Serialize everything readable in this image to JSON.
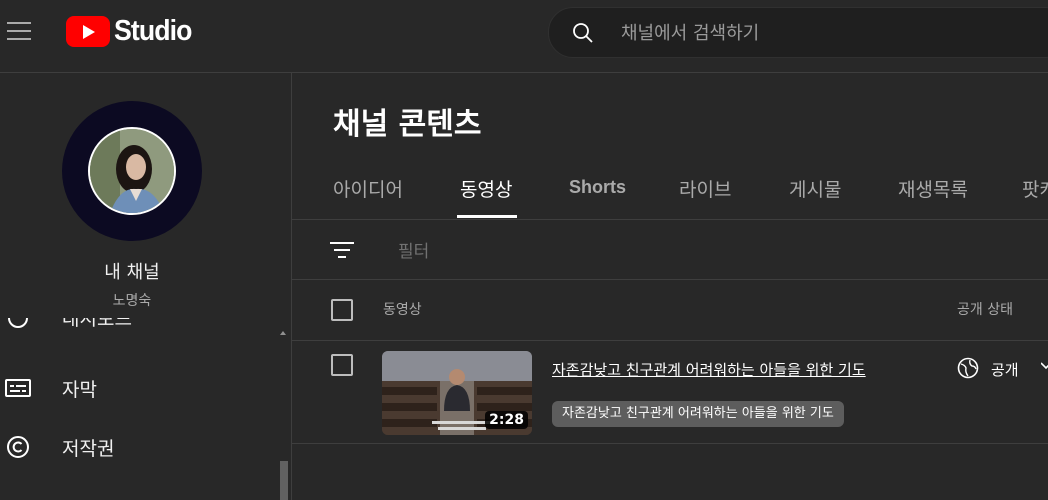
{
  "header": {
    "logo_text": "Studio",
    "search_placeholder": "채널에서 검색하기"
  },
  "sidebar": {
    "channel_name": "내 채널",
    "channel_owner": "노명숙",
    "cut_item_label": "대시보드",
    "items": [
      {
        "label": "자막",
        "icon": "subtitles-icon"
      },
      {
        "label": "저작권",
        "icon": "copyright-icon"
      }
    ]
  },
  "main": {
    "title": "채널 콘텐츠",
    "tabs": [
      {
        "label": "아이디어"
      },
      {
        "label": "동영상",
        "active": true
      },
      {
        "label": "Shorts"
      },
      {
        "label": "라이브"
      },
      {
        "label": "게시물"
      },
      {
        "label": "재생목록"
      },
      {
        "label": "팟캐스트"
      }
    ],
    "filter_label": "필터",
    "columns": {
      "video": "동영상",
      "visibility": "공개 상태"
    },
    "videos": [
      {
        "title": "자존감낮고 친구관계 어려워하는 아들을 위한 기도",
        "tooltip": "자존감낮고 친구관계 어려워하는 아들을 위한 기도",
        "duration": "2:28",
        "visibility": "공개"
      }
    ]
  },
  "colors": {
    "background": "#282828",
    "brand_red": "#ff0000",
    "border": "#3e3e3e"
  }
}
